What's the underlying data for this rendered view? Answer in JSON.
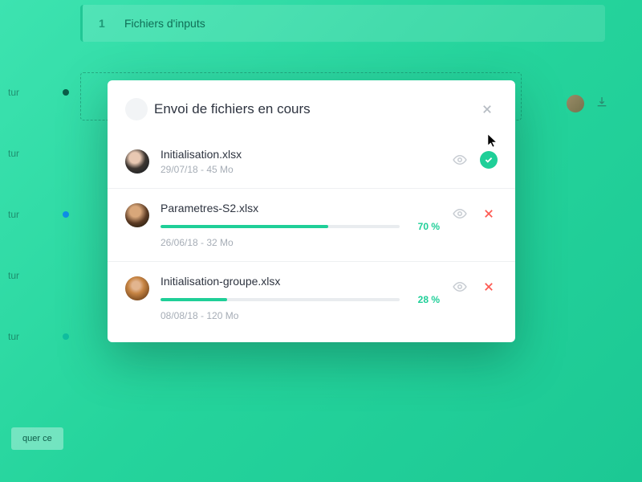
{
  "background": {
    "step_number": "1",
    "step_label": "Fichiers d'inputs",
    "row_label": "tur",
    "chip_label": "quer ce"
  },
  "modal": {
    "title": "Envoi de fichiers en cours",
    "files": [
      {
        "name": "Initialisation.xlsx",
        "meta": "29/07/18 - 45 Mo",
        "status": "done"
      },
      {
        "name": "Parametres-S2.xlsx",
        "meta": "26/06/18 - 32 Mo",
        "progress_pct": "70 %",
        "status": "uploading"
      },
      {
        "name": "Initialisation-groupe.xlsx",
        "meta": "08/08/18 - 120 Mo",
        "progress_pct": "28 %",
        "status": "uploading"
      }
    ]
  },
  "colors": {
    "accent": "#1fcf98",
    "danger": "#fd5a52"
  }
}
